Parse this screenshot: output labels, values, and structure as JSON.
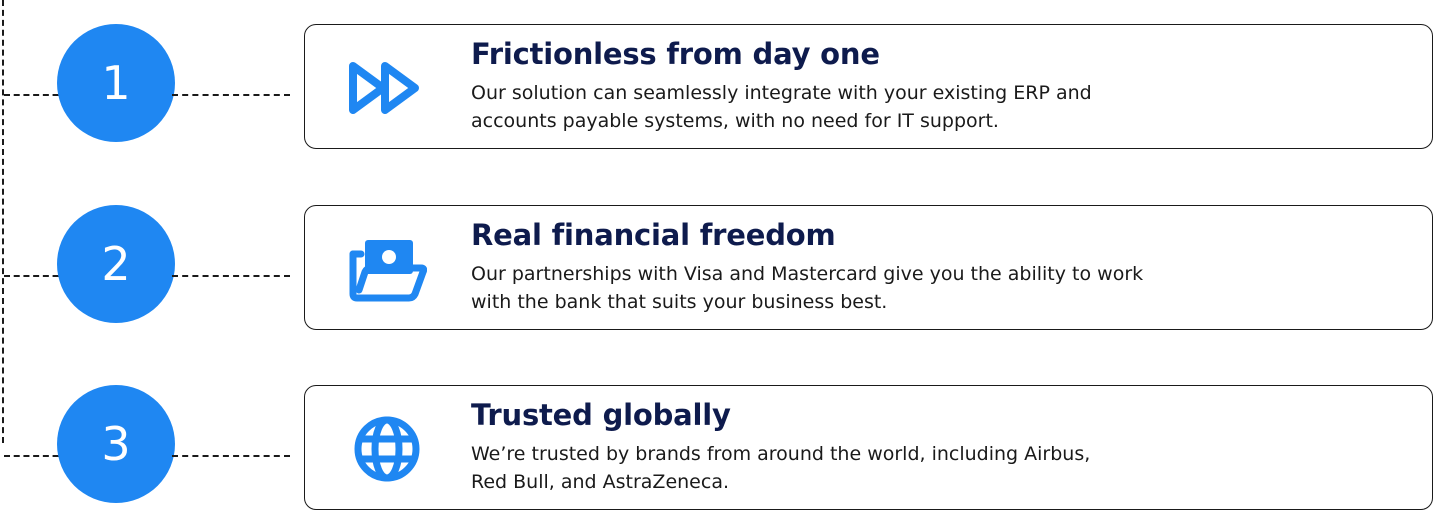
{
  "colors": {
    "accent": "#1f87f2",
    "title": "#0e1b4d",
    "text": "#1a1a1a",
    "border": "#1a1a1a"
  },
  "steps": [
    {
      "number": "1",
      "icon": "fast-forward-icon",
      "title": "Frictionless from day one",
      "line1": "Our solution can seamlessly integrate with your existing ERP and",
      "line2": "accounts payable systems, with no need for IT support."
    },
    {
      "number": "2",
      "icon": "money-folder-icon",
      "title": "Real financial freedom",
      "line1": "Our partnerships with Visa and Mastercard give you the ability to work",
      "line2": "with the bank that suits your business best."
    },
    {
      "number": "3",
      "icon": "globe-icon",
      "title": "Trusted globally",
      "line1": "We’re trusted by brands from around the world, including Airbus,",
      "line2": "Red Bull, and AstraZeneca."
    }
  ]
}
